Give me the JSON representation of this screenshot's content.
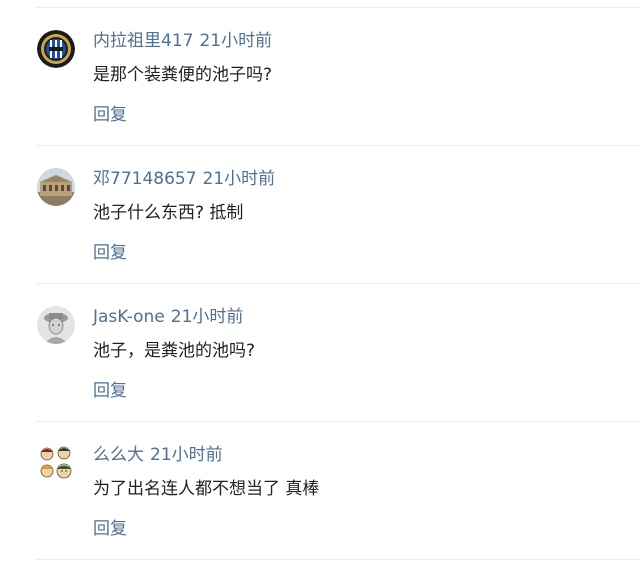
{
  "comments": [
    {
      "username": "内拉祖里417",
      "time": "21小时前",
      "content": "是那个装粪便的池子吗?",
      "reply_label": "回复",
      "avatar_icon": "inter-milan-logo-icon"
    },
    {
      "username": "邓77148657",
      "time": "21小时前",
      "content": "池子什么东西? 抵制",
      "reply_label": "回复",
      "avatar_icon": "palace-building-icon"
    },
    {
      "username": "JasK-one",
      "time": "21小时前",
      "content": "池子，是粪池的池吗?",
      "reply_label": "回复",
      "avatar_icon": "sketch-portrait-icon"
    },
    {
      "username": "么么大",
      "time": "21小时前",
      "content": "为了出名连人都不想当了 真棒",
      "reply_label": "回复",
      "avatar_icon": "cartoon-faces-icon"
    }
  ],
  "colors": {
    "link": "#4f6f95",
    "text": "#222222",
    "divider": "#ececec"
  }
}
